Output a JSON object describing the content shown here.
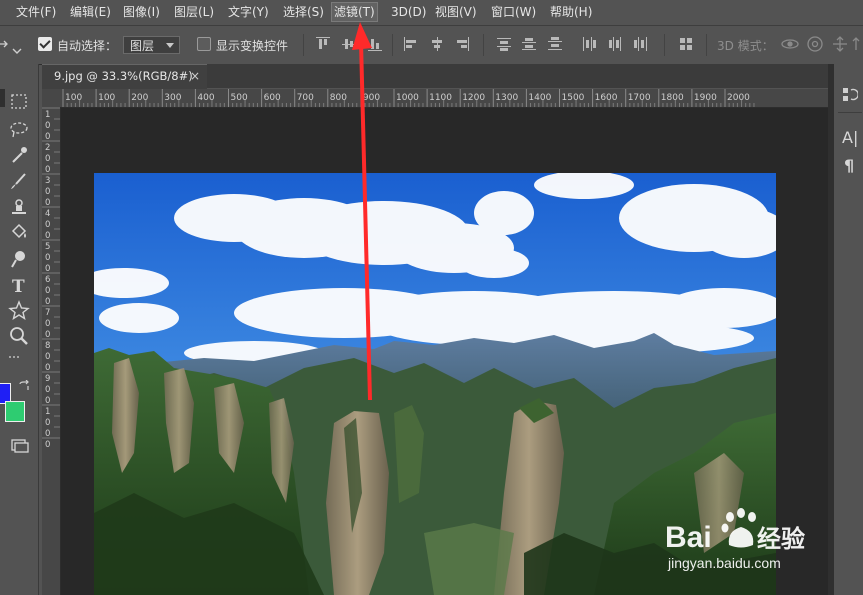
{
  "menu": [
    {
      "label": "文件(F)"
    },
    {
      "label": "编辑(E)"
    },
    {
      "label": "图像(I)"
    },
    {
      "label": "图层(L)"
    },
    {
      "label": "文字(Y)"
    },
    {
      "label": "选择(S)"
    },
    {
      "label": "滤镜(T)"
    },
    {
      "label": "3D(D)"
    },
    {
      "label": "视图(V)"
    },
    {
      "label": "窗口(W)"
    },
    {
      "label": "帮助(H)"
    }
  ],
  "options": {
    "auto_select_label": "自动选择：",
    "auto_select_checked": true,
    "layer_select_value": "图层",
    "show_transform_label": "显示变换控件",
    "show_transform_checked": false,
    "mode_3d_label": "3D 模式："
  },
  "document": {
    "tab_title": "9.jpg @ 33.3%(RGB/8#)",
    "close_glyph": "×"
  },
  "ruler": {
    "top_ticks": [
      "100",
      "100",
      "200",
      "300",
      "400",
      "500",
      "600",
      "700",
      "800",
      "900",
      "1000",
      "1100",
      "1200",
      "1300",
      "1400",
      "1500",
      "1600",
      "1700",
      "1800",
      "1900",
      "2000"
    ],
    "left_ticks": [
      "1",
      "0",
      "0",
      "2",
      "0",
      "0",
      "3",
      "0",
      "0",
      "4",
      "0",
      "0",
      "5",
      "0",
      "0",
      "6",
      "0",
      "0",
      "7",
      "0",
      "0",
      "8",
      "0",
      "0",
      "9",
      "0",
      "0",
      "1",
      "0",
      "0",
      "0"
    ]
  },
  "colors": {
    "foreground": "#1f1ff5",
    "background": "#2ecc71",
    "annotation_arrow": "#ff2a2a"
  },
  "right_dock": {
    "char_icon_glyph": "A|",
    "para_icon_glyph": "¶"
  },
  "watermark": {
    "brand": "Bai",
    "brand_suffix": "经验",
    "url": "jingyan.baidu.com"
  }
}
